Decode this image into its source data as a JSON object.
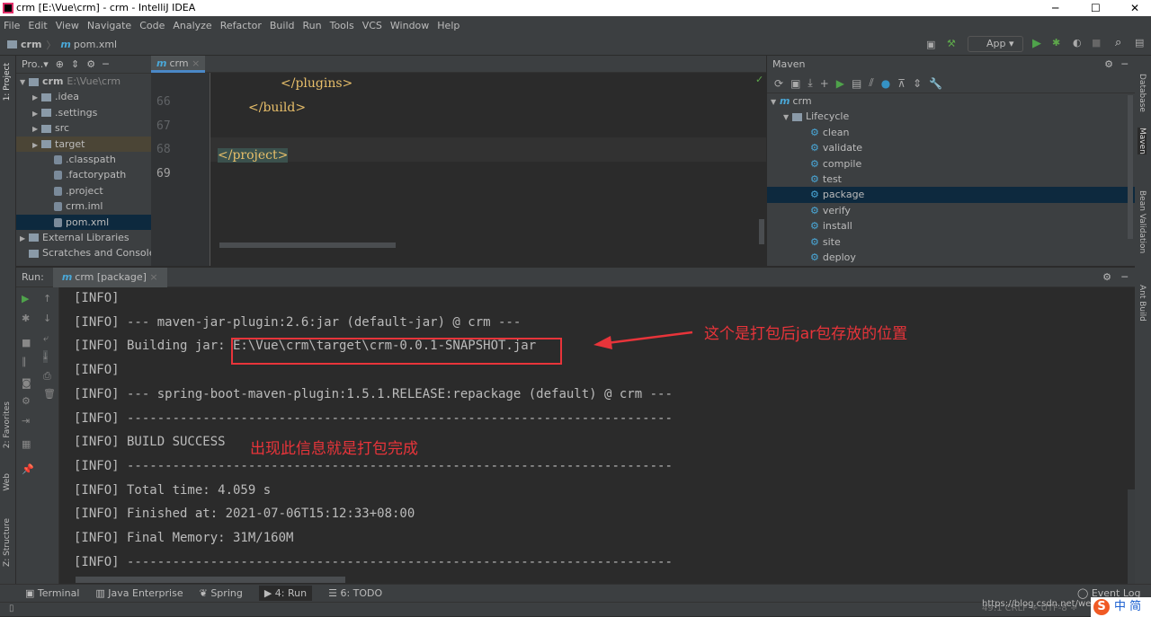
{
  "window": {
    "title": "crm [E:\\Vue\\crm] - crm - IntelliJ IDEA",
    "min": "─",
    "max": "☐",
    "close": "✕"
  },
  "menu": [
    "File",
    "Edit",
    "View",
    "Navigate",
    "Code",
    "Analyze",
    "Refactor",
    "Build",
    "Run",
    "Tools",
    "VCS",
    "Window",
    "Help"
  ],
  "nav": {
    "project": "crm",
    "file": "pom.xml",
    "run_config": "App"
  },
  "project": {
    "header": "Pro..▾",
    "items": [
      {
        "label": "crm",
        "extra": "E:\\Vue\\crm",
        "level": 0,
        "arrow": "▼"
      },
      {
        "label": ".idea",
        "level": 1,
        "arrow": "▶"
      },
      {
        "label": ".settings",
        "level": 1,
        "arrow": "▶"
      },
      {
        "label": "src",
        "level": 1,
        "arrow": "▶"
      },
      {
        "label": "target",
        "level": 1,
        "arrow": "▶"
      },
      {
        "label": ".classpath",
        "level": 2
      },
      {
        "label": ".factorypath",
        "level": 2
      },
      {
        "label": ".project",
        "level": 2
      },
      {
        "label": "crm.iml",
        "level": 2
      },
      {
        "label": "pom.xml",
        "level": 2
      },
      {
        "label": "External Libraries",
        "level": 0,
        "arrow": "▶"
      },
      {
        "label": "Scratches and Consoles",
        "level": 0
      }
    ]
  },
  "editor": {
    "tab": "crm",
    "lines": [
      {
        "n": "66",
        "code": "</plugins>"
      },
      {
        "n": "67",
        "code": "</build>"
      },
      {
        "n": "68",
        "code": ""
      },
      {
        "n": "69",
        "code": "</project>"
      }
    ]
  },
  "maven": {
    "title": "Maven",
    "root": "crm",
    "lifecycle": "Lifecycle",
    "goals": [
      "clean",
      "validate",
      "compile",
      "test",
      "package",
      "verify",
      "install",
      "site",
      "deploy"
    ],
    "selected": "package"
  },
  "side": {
    "left": [
      "1: Project",
      "2: Favorites",
      "Web",
      "Z: Structure"
    ],
    "right": [
      "Database",
      "Maven",
      "Bean Validation",
      "Ant Build"
    ]
  },
  "run": {
    "label": "Run:",
    "tab": "crm [package]",
    "lines": [
      "[INFO]",
      "[INFO] --- maven-jar-plugin:2.6:jar (default-jar) @ crm ---",
      "[INFO] Building jar: E:\\Vue\\crm\\target\\crm-0.0.1-SNAPSHOT.jar",
      "[INFO]",
      "[INFO] --- spring-boot-maven-plugin:1.5.1.RELEASE:repackage (default) @ crm ---",
      "[INFO] ------------------------------------------------------------------------",
      "[INFO] BUILD SUCCESS",
      "[INFO] ------------------------------------------------------------------------",
      "[INFO] Total time: 4.059 s",
      "[INFO] Finished at: 2021-07-06T15:12:33+08:00",
      "[INFO] Final Memory: 31M/160M",
      "[INFO] ------------------------------------------------------------------------"
    ]
  },
  "annotations": {
    "jar_location": "这个是打包后jar包存放的位置",
    "build_done": "出现此信息就是打包完成"
  },
  "bottom": {
    "tools": [
      "Terminal",
      "Java Enterprise",
      "Spring",
      "4: Run",
      "6: TODO"
    ],
    "event_log": "Event Log"
  },
  "status": {
    "text": "49:1  CRLF ÷  UTF-8 ÷",
    "watermark": "https://blog.csdn.net/weixi",
    "ime": "中 简"
  }
}
